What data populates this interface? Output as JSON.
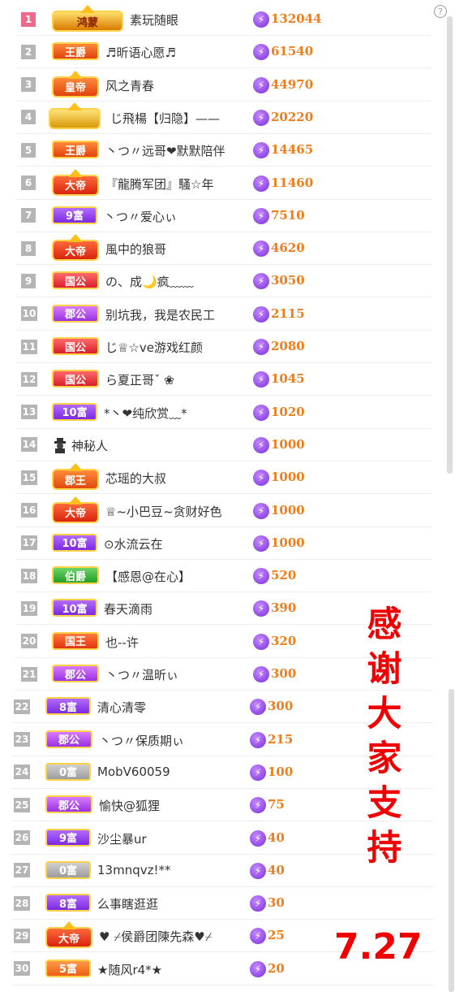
{
  "rows": [
    {
      "rank": "1",
      "badge": "鸿蒙",
      "name": "素玩随眼",
      "amount": "132044"
    },
    {
      "rank": "2",
      "badge": "王爵",
      "name": "♬昕语心愿♬",
      "amount": "61540"
    },
    {
      "rank": "3",
      "badge": "皇帝",
      "name": "风之青春",
      "amount": "44970"
    },
    {
      "rank": "4",
      "badge": "",
      "name": "じ飛楊【归隐】——",
      "amount": "20220"
    },
    {
      "rank": "5",
      "badge": "王爵",
      "name": "丶つ〃远哥❤默默陪伴",
      "amount": "14465"
    },
    {
      "rank": "6",
      "badge": "大帝",
      "name": "『龍腾军团』騷☆年",
      "amount": "11460"
    },
    {
      "rank": "7",
      "badge": "9富",
      "name": "丶つ〃爱心ぃ",
      "amount": "7510"
    },
    {
      "rank": "8",
      "badge": "大帝",
      "name": "風中的狼哥",
      "amount": "4620"
    },
    {
      "rank": "9",
      "badge": "国公",
      "name": "の、成🌙疯﹏﹏",
      "amount": "3050"
    },
    {
      "rank": "10",
      "badge": "郡公",
      "name": "别坑我，我是农民工",
      "amount": "2115"
    },
    {
      "rank": "11",
      "badge": "国公",
      "name": "じ♕☆ve游戏红颜",
      "amount": "2080"
    },
    {
      "rank": "12",
      "badge": "国公",
      "name": "ら夏正哥ˇ ❀",
      "amount": "1045"
    },
    {
      "rank": "13",
      "badge": "10富",
      "name": "*丶❤纯欣赏﹏*",
      "amount": "1020"
    },
    {
      "rank": "14",
      "badge": "",
      "name": "神秘人",
      "amount": "1000"
    },
    {
      "rank": "15",
      "badge": "郡王",
      "name": "芯瑶的大叔",
      "amount": "1000"
    },
    {
      "rank": "16",
      "badge": "大帝",
      "name": "♕~小巴豆~贪财好色",
      "amount": "1000"
    },
    {
      "rank": "17",
      "badge": "10富",
      "name": "⊙水流云在",
      "amount": "1000"
    },
    {
      "rank": "18",
      "badge": "伯爵",
      "name": "【感恩@在心】",
      "amount": "520"
    },
    {
      "rank": "19",
      "badge": "10富",
      "name": "春天滴雨",
      "amount": "390"
    },
    {
      "rank": "20",
      "badge": "国王",
      "name": "也--许",
      "amount": "320"
    },
    {
      "rank": "21",
      "badge": "郡公",
      "name": "丶つ〃温昕ぃ",
      "amount": "300"
    },
    {
      "rank": "22",
      "badge": "8富",
      "name": "清心清零",
      "amount": "300"
    },
    {
      "rank": "23",
      "badge": "郡公",
      "name": "丶つ〃保质期ぃ",
      "amount": "215"
    },
    {
      "rank": "24",
      "badge": "0富",
      "name": "MobV60059",
      "amount": "100"
    },
    {
      "rank": "25",
      "badge": "郡公",
      "name": "愉快@狐狸",
      "amount": "75"
    },
    {
      "rank": "26",
      "badge": "9富",
      "name": "沙尘暴ur",
      "amount": "40"
    },
    {
      "rank": "27",
      "badge": "0富",
      "name": "13mnqvz!**",
      "amount": "40"
    },
    {
      "rank": "28",
      "badge": "8富",
      "name": "么事瞎逛逛",
      "amount": "30"
    },
    {
      "rank": "29",
      "badge": "大帝",
      "name": "♥ ⌿侯爵团陳先森♥⌿",
      "amount": "25"
    },
    {
      "rank": "30",
      "badge": "5富",
      "name": "★随风r4*★",
      "amount": "20"
    }
  ],
  "thanks_chars": [
    "感",
    "谢",
    "大",
    "家",
    "支",
    "持"
  ],
  "date": "7.27",
  "help_symbol": "?",
  "coin_symbol": "⚡"
}
